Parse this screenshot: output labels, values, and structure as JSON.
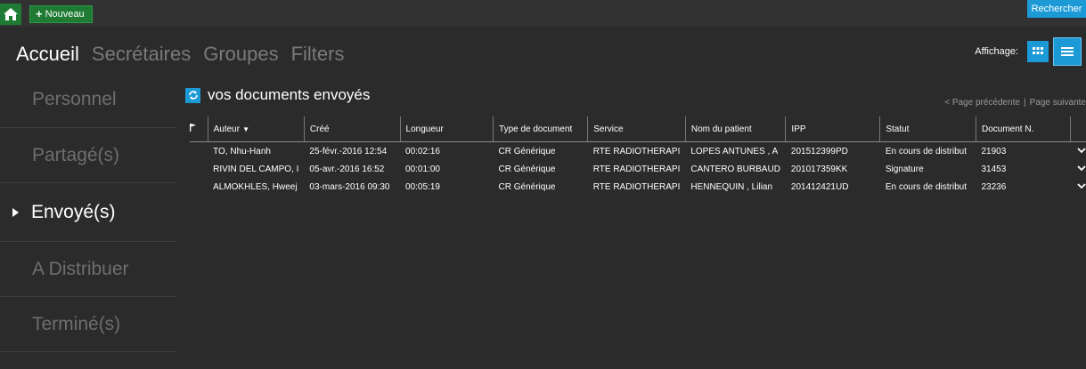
{
  "topbar": {
    "new_label": "Nouveau",
    "search_label": "Rechercher"
  },
  "nav": {
    "tabs": [
      "Accueil",
      "Secrétaires",
      "Groupes",
      "Filters"
    ]
  },
  "display": {
    "label": "Affichage:"
  },
  "sidebar": {
    "items": [
      "Personnel",
      "Partagé(s)",
      "Envoyé(s)",
      "A Distribuer",
      "Terminé(s)"
    ]
  },
  "main": {
    "title": "vos documents envoyés",
    "prev": "< Page précédente",
    "next": "Page suivante"
  },
  "table": {
    "headers": [
      "Auteur",
      "Créé",
      "Longueur",
      "Type de document",
      "Service",
      "Nom du patient",
      "IPP",
      "Statut",
      "Document N."
    ],
    "rows": [
      [
        "TO, Nhu-Hanh",
        "25-févr.-2016 12:54",
        "00:02:16",
        "CR Générique",
        "RTE RADIOTHERAPI",
        "LOPES ANTUNES , A",
        "201512399PD",
        "En cours de distribut",
        "21903"
      ],
      [
        "RIVIN DEL CAMPO, I",
        "05-avr.-2016 16:52",
        "00:01:00",
        "CR Générique",
        "RTE RADIOTHERAPI",
        "CANTERO BURBAUD",
        "201017359KK",
        "Signature",
        "31453"
      ],
      [
        "ALMOKHLES, Hweej",
        "03-mars-2016 09:30",
        "00:05:19",
        "CR Générique",
        "RTE RADIOTHERAPI",
        "HENNEQUIN , Lilian",
        "201412421UD",
        "En cours de distribut",
        "23236"
      ]
    ]
  },
  "colors": {
    "accent": "#1c9ad6",
    "new_button": "#1f7a33",
    "background": "#2b2b2b"
  }
}
